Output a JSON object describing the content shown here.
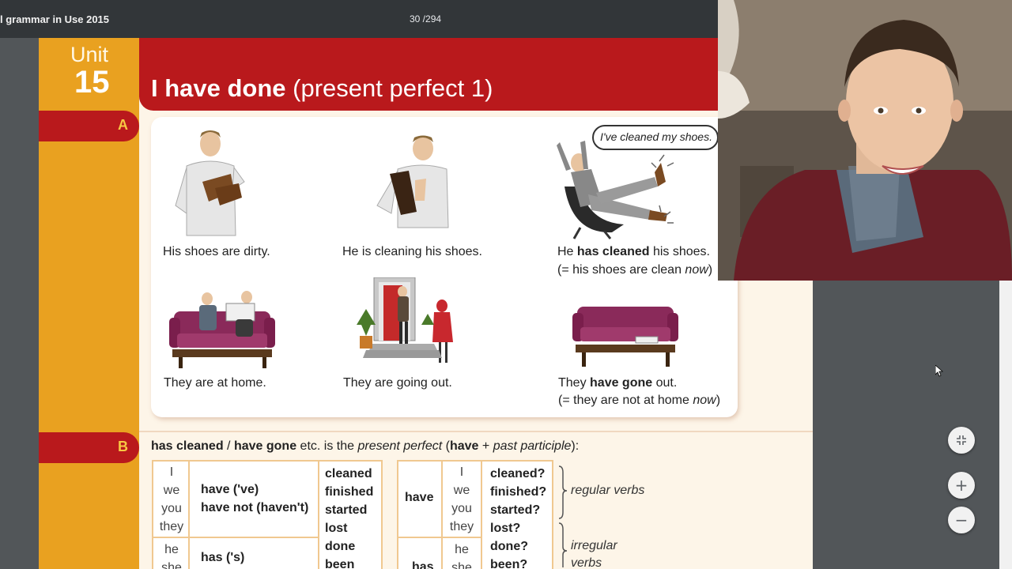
{
  "viewer": {
    "document_title": "l grammar in Use 2015",
    "page_counter": "30 /294",
    "controls": {
      "fit_icon": "fit-to-page-icon",
      "zoom_in_label": "+",
      "zoom_out_label": "−"
    }
  },
  "page": {
    "unit_label": "Unit",
    "unit_number": "15",
    "title_bold": "I have done",
    "title_rest": " (present perfect 1)",
    "section_a": {
      "letter": "A",
      "speech_bubble": "I've cleaned my shoes.",
      "captions": {
        "c1": "His shoes are dirty.",
        "c2": "He is cleaning his shoes.",
        "c3_pre": "He ",
        "c3_bold": "has cleaned",
        "c3_post": " his shoes.",
        "c3_line2_pre": "(= his shoes are clean ",
        "c3_line2_it": "now",
        "c3_line2_post": ")",
        "c4": "They are at home.",
        "c5": "They are going out.",
        "c6_pre": "They ",
        "c6_bold": "have gone",
        "c6_post": " out.",
        "c6_line2_pre": "(= they are not at home ",
        "c6_line2_it": "now",
        "c6_line2_post": ")"
      }
    },
    "section_b": {
      "letter": "B",
      "intro": {
        "b1": "has cleaned",
        "t1": " / ",
        "b2": "have gone",
        "t2": " etc. is the ",
        "i1": "present perfect",
        "t3": " (",
        "b3": "have",
        "t4": " + ",
        "i2": "past participle",
        "t5": "):"
      },
      "table_left": {
        "pronouns_top": [
          "I",
          "we",
          "you",
          "they"
        ],
        "aux_top": [
          "have ('ve)",
          "have not (haven't)"
        ],
        "pronouns_bottom": [
          "he",
          "she"
        ],
        "aux_bottom": [
          "has ('s)"
        ],
        "verbs": [
          "cleaned",
          "finished",
          "started",
          "lost",
          "done",
          "been"
        ]
      },
      "table_right": {
        "aux_top": "have",
        "pronouns_top": [
          "I",
          "we",
          "you",
          "they"
        ],
        "aux_bottom": "has",
        "pronouns_bottom": [
          "he",
          "she"
        ],
        "verbs": [
          "cleaned?",
          "finished?",
          "started?",
          "lost?",
          "done?",
          "been?"
        ]
      },
      "notes": {
        "regular": "regular verbs",
        "irregular_1": "irregular",
        "irregular_2": "verbs"
      }
    }
  },
  "colors": {
    "viewer_bg": "#525659",
    "toolbar": "#323639",
    "unit_orange": "#e9a120",
    "title_red": "#b9191c",
    "page_cream": "#fdf5e8"
  }
}
